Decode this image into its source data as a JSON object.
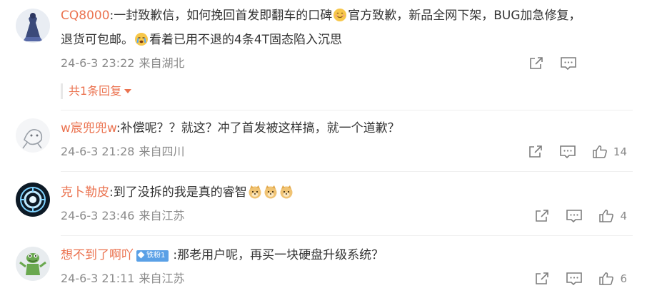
{
  "comments": [
    {
      "username": "CQ8000",
      "text_part1": "一封致歉信，如何挽回首发即翻车的口碑",
      "text_part2": "官方致歉，新品全网下架，BUG加急修复，",
      "text_line2_part1": "退货可包邮。",
      "text_line2_part2": "看着已用不退的4条4T固态陷入沉思",
      "time": "24-6-3 23:22",
      "location": "来自湖北",
      "replies_label": "共1条回复"
    },
    {
      "username": "w宸兜兜w",
      "text": "补偿呢？？就这？冲了首发被这样搞，就一个道歉？",
      "time": "24-6-3 21:28",
      "location": "来自四川",
      "likes": "14"
    },
    {
      "username": "克卜勒皮",
      "text": "到了没拆的我是真的睿智",
      "time": "24-6-3 23:46",
      "location": "来自江苏",
      "likes": "4"
    },
    {
      "username": "想不到了啊吖",
      "badge": "铁粉1",
      "text": "那老用户呢，再买一块硬盘升级系统？",
      "time": "24-6-3 21:11",
      "location": "来自江苏",
      "likes": "6"
    }
  ],
  "separator": ":",
  "icons": {
    "share": "share-icon",
    "comment": "comment-icon",
    "like": "like-icon",
    "emoji_smile": "smile-emoji-icon",
    "emoji_cry": "cry-emoji-icon",
    "emoji_doge": "doge-emoji-icon"
  },
  "colors": {
    "username": "#eb7350",
    "text": "#333333",
    "meta": "#8a8a8a",
    "badge": "#5aa0e6"
  }
}
